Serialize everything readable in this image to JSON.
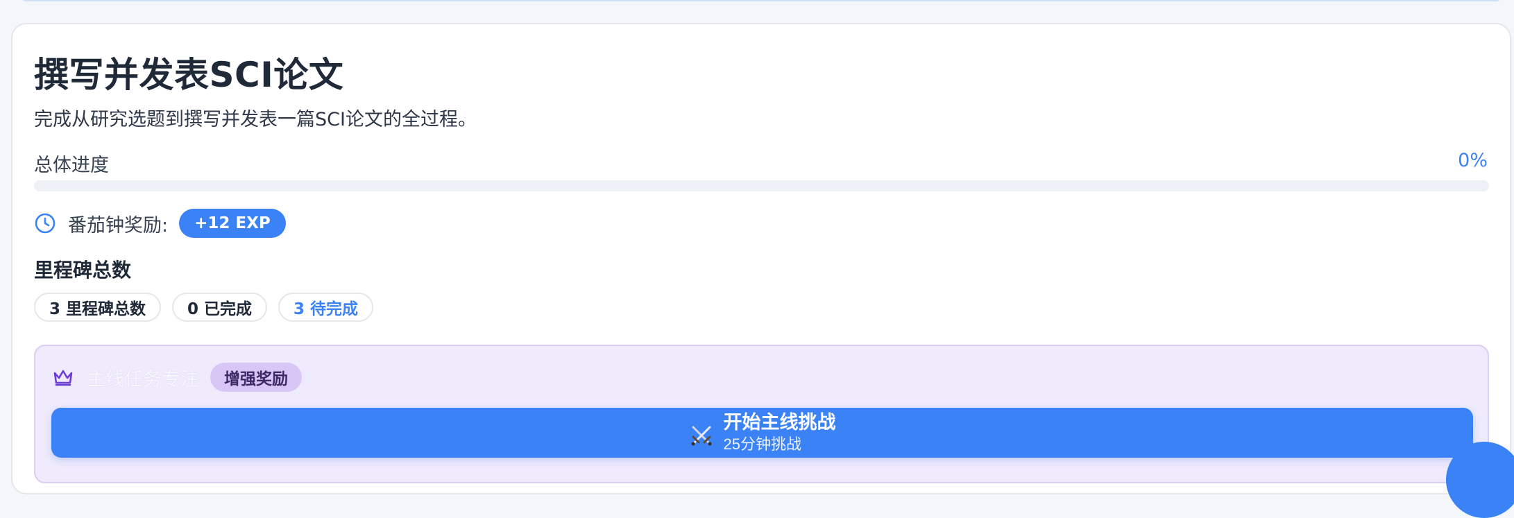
{
  "goal": {
    "title": "撰写并发表SCI论文",
    "description": "完成从研究选题到撰写并发表一篇SCI论文的全过程。"
  },
  "progress": {
    "label": "总体进度",
    "percent_text": "0%",
    "fraction": 0.0
  },
  "reward": {
    "icon": "clock-icon",
    "label": "番茄钟奖励:",
    "exp_badge": "+12 EXP"
  },
  "milestones": {
    "title": "里程碑总数",
    "pills": [
      {
        "label": "3 里程碑总数"
      },
      {
        "label": "0 已完成"
      },
      {
        "label": "3 待完成"
      }
    ]
  },
  "main_quest": {
    "icon": "crown-icon",
    "title": "主线任务专注",
    "badge": "增强奖励",
    "button": {
      "icon": "crossed-swords-icon",
      "label": "开始主线挑战",
      "sublabel": "25分钟挑战"
    }
  },
  "colors": {
    "accent": "#3b82f6",
    "quest_panel_bg": "#efeafc",
    "quest_badge_bg": "#d7c6f6",
    "crown": "#6d3bd6"
  }
}
